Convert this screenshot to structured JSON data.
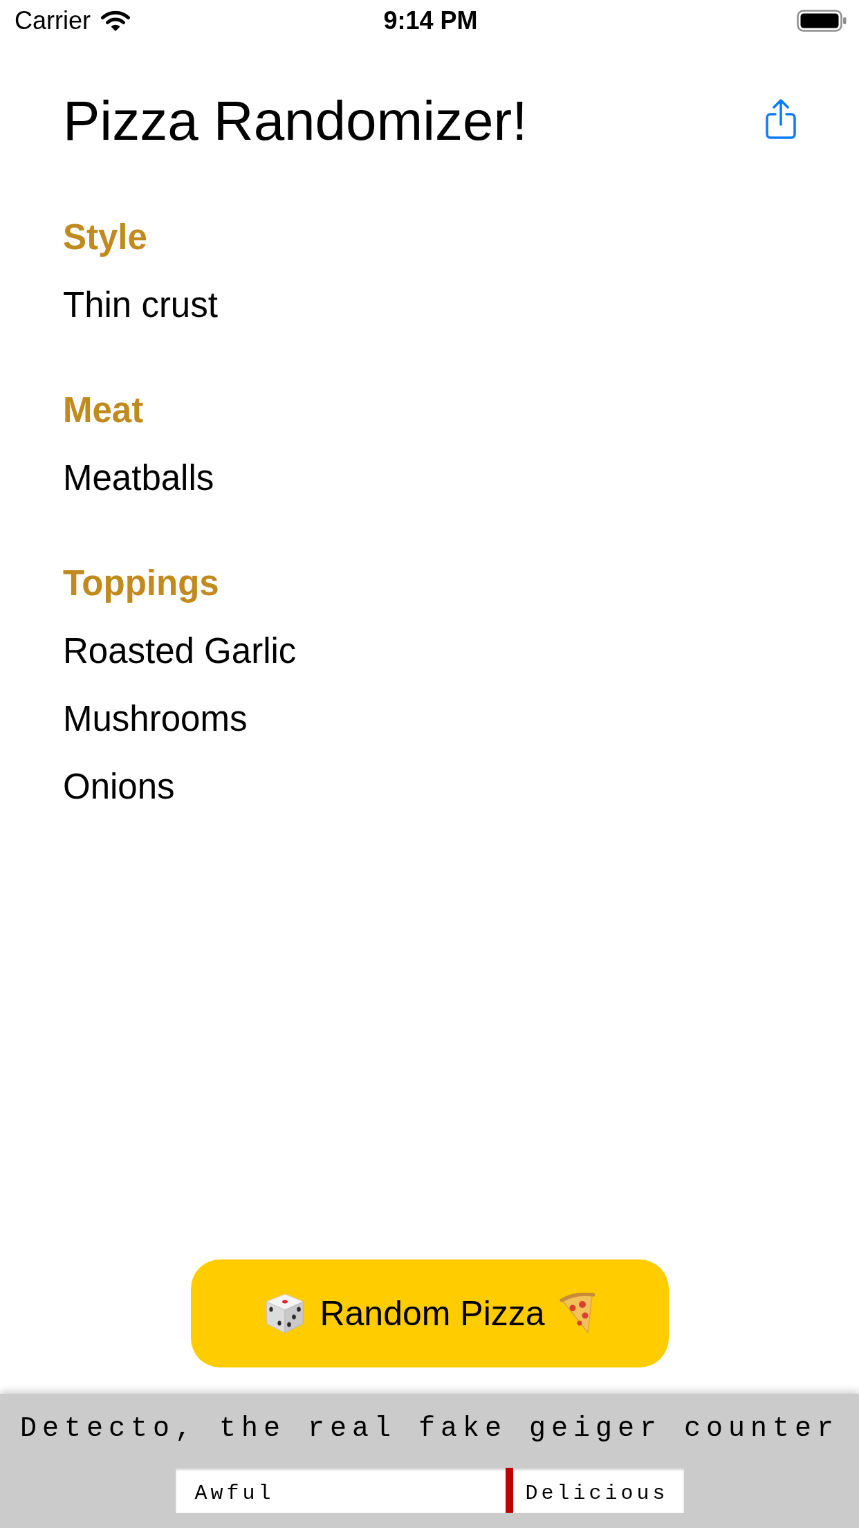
{
  "status_bar": {
    "carrier": "Carrier",
    "time": "9:14 PM"
  },
  "navigation": {
    "title": "Pizza Randomizer!"
  },
  "sections": [
    {
      "heading": "Style",
      "items": [
        "Thin crust"
      ]
    },
    {
      "heading": "Meat",
      "items": [
        "Meatballs"
      ]
    },
    {
      "heading": "Toppings",
      "items": [
        "Roasted Garlic",
        "Mushrooms",
        "Onions"
      ]
    }
  ],
  "button": {
    "label": "Random Pizza"
  },
  "ad_banner": {
    "headline": "Detecto, the real fake geiger counter",
    "meter": {
      "low_label": "Awful",
      "high_label": "Delicious",
      "level": 0.65
    }
  }
}
